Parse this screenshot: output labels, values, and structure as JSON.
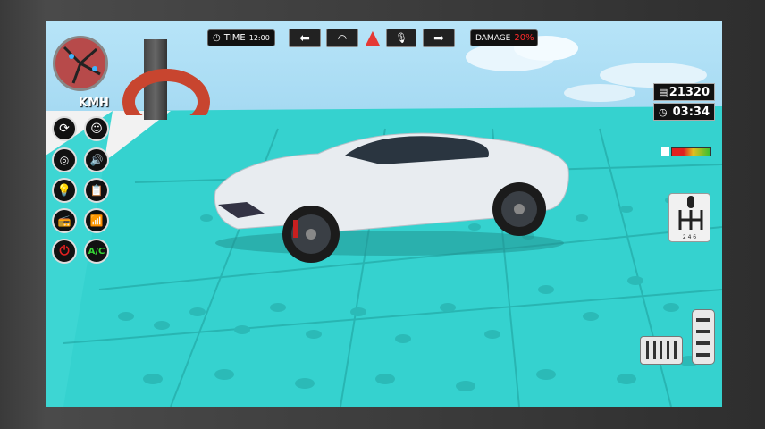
{
  "hud": {
    "speed_unit": "KMH",
    "time_label": "TIME",
    "time_value": "12:00",
    "damage_label": "DAMAGE",
    "damage_value": "20%",
    "coins": "21320",
    "timer": "03:34",
    "ac_label": "A/C",
    "gear_labels": "2 4 6"
  },
  "colors": {
    "floor": "#35d6d2",
    "damage_accent": "#ff2a2a",
    "ac_text": "#36d636",
    "power": "#e02020",
    "hazard": "#e53935"
  },
  "icons": {
    "left_column": [
      "refresh-icon",
      "driver-icon",
      "horn-icon",
      "volume-icon",
      "headlight-icon",
      "clipboard-icon",
      "radio-icon",
      "wifi-icon",
      "power-icon",
      "ac-icon"
    ]
  }
}
